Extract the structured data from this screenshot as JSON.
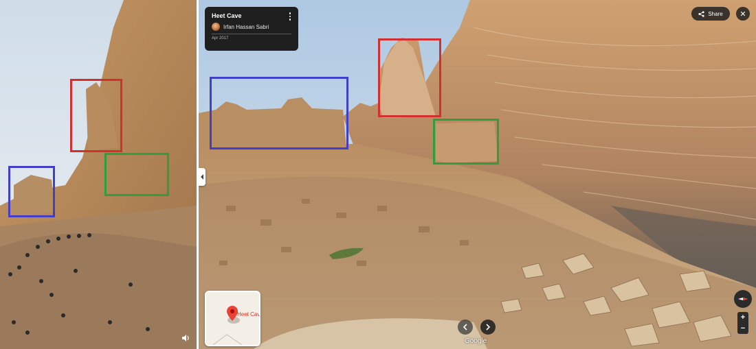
{
  "info_card": {
    "title": "Heet Cave",
    "author": "Irfan Hassan Sabri",
    "date": "Apr 2017"
  },
  "toolbar": {
    "share_label": "Share",
    "close_symbol": "✕"
  },
  "minimap": {
    "place_label": "Heet Cave"
  },
  "branding": {
    "logo_text": "Google"
  },
  "zoom": {
    "in_symbol": "+",
    "out_symbol": "−"
  },
  "icons": {
    "share": "share-icon",
    "close": "close-icon",
    "more": "more-vert-icon",
    "collapse": "chevron-left-icon",
    "nav_prev": "chevron-left-icon",
    "nav_next": "chevron-right-icon",
    "compass": "compass-icon",
    "pin": "map-pin-icon",
    "volume": "volume-icon"
  },
  "highlight_boxes": {
    "colors": [
      "#d32f2f",
      "#3f3fc8",
      "#2e9e3e"
    ]
  }
}
